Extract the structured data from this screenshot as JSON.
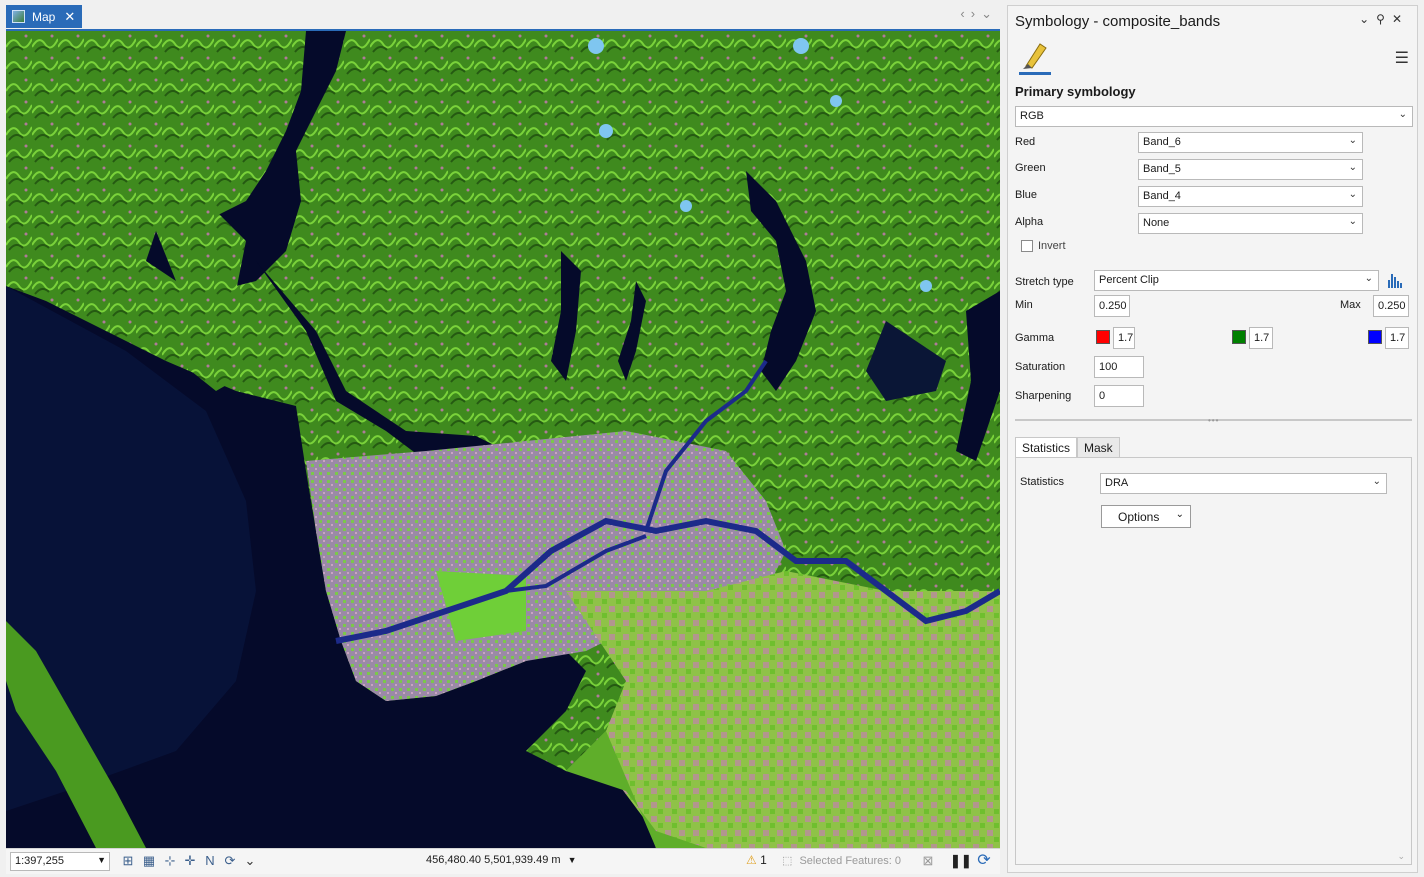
{
  "map": {
    "tab_label": "Map",
    "scale": "1:397,255",
    "coordinates": "456,480.40 5,501,939.49 m",
    "warning_count": "1",
    "selected_features": "Selected Features: 0"
  },
  "symbology": {
    "title": "Symbology - composite_bands",
    "primary_label": "Primary symbology",
    "primary_value": "RGB",
    "red_label": "Red",
    "red_value": "Band_6",
    "green_label": "Green",
    "green_value": "Band_5",
    "blue_label": "Blue",
    "blue_value": "Band_4",
    "alpha_label": "Alpha",
    "alpha_value": "None",
    "invert_label": "Invert",
    "stretch_label": "Stretch type",
    "stretch_value": "Percent Clip",
    "min_label": "Min",
    "min_value": "0.250",
    "max_label": "Max",
    "max_value": "0.250",
    "gamma_label": "Gamma",
    "gamma_red": "1.7",
    "gamma_green": "1.7",
    "gamma_blue": "1.7",
    "saturation_label": "Saturation",
    "saturation_value": "100",
    "sharpening_label": "Sharpening",
    "sharpening_value": "0",
    "tabs": [
      "Statistics",
      "Mask"
    ],
    "statistics_label": "Statistics",
    "statistics_value": "DRA",
    "options_label": "Options",
    "colors": {
      "red": "#ff0000",
      "green": "#008000",
      "blue": "#0000ff",
      "accent": "#2a6bb8"
    }
  }
}
